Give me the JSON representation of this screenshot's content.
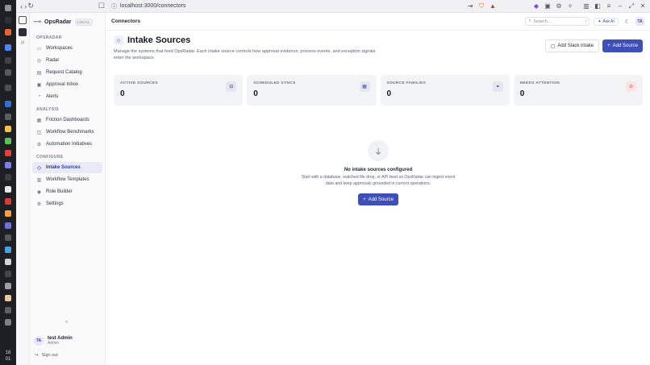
{
  "dock": {
    "clock_hour": "18",
    "clock_min": "01",
    "colors": [
      "#8f939a",
      "#2e3138",
      "#e8632d",
      "#4a87f5",
      "#3f4348",
      "#58595e",
      "#4b4e55",
      "#2f6fd6",
      "#5a5d63",
      "#f0c343",
      "#5cbf57",
      "#e2413a",
      "#7b7fe8",
      "#3a3d42",
      "#e9e9e9",
      "#d93b3b",
      "#efa33a",
      "#6c6fe0",
      "#55595f",
      "#47a3e0",
      "#cfd2d6",
      "#43464b",
      "#9a9ea4",
      "#e8c9a4",
      "#5c6066",
      "#7e8287"
    ]
  },
  "browser": {
    "url": "localhost:3000/connectors"
  },
  "sidebar": {
    "brand_name": "OpsRadar",
    "brand_badge": "LOCAL",
    "sections": [
      {
        "label": "OPSRADAR",
        "items": [
          {
            "label": "Workspaces",
            "icon": "folder-icon"
          },
          {
            "label": "Radar",
            "icon": "radar-icon"
          },
          {
            "label": "Request Catalog",
            "icon": "catalog-icon"
          },
          {
            "label": "Approval Inbox",
            "icon": "inbox-icon"
          },
          {
            "label": "Alerts",
            "icon": "bell-icon"
          }
        ]
      },
      {
        "label": "ANALYSIS",
        "items": [
          {
            "label": "Friction Dashboards",
            "icon": "dashboard-icon"
          },
          {
            "label": "Workflow Benchmarks",
            "icon": "benchmark-icon"
          },
          {
            "label": "Automation Initiatives",
            "icon": "gear-icon"
          }
        ]
      },
      {
        "label": "CONFIGURE",
        "items": [
          {
            "label": "Intake Sources",
            "icon": "intake-icon",
            "active": true
          },
          {
            "label": "Workflow Templates",
            "icon": "template-icon"
          },
          {
            "label": "Role Builder",
            "icon": "role-icon"
          },
          {
            "label": "Settings",
            "icon": "settings-icon"
          }
        ]
      }
    ],
    "collapse_glyph": "«",
    "user": {
      "initials": "TA",
      "name": "test Admin",
      "role": "Admin"
    },
    "sign_out": "Sign out"
  },
  "topbar": {
    "breadcrumb": "Connectors",
    "search_placeholder": "Search...",
    "search_kbd": "/",
    "ask_ai": "Ask AI",
    "avatar_initials": "TA"
  },
  "page": {
    "title": "Intake Sources",
    "description": "Manage the systems that feed OpsRadar. Each intake source controls how approval evidence, process events, and exception signals enter the workspace.",
    "add_slack": "Add Slack intake",
    "add_source": "Add Source"
  },
  "stats": [
    {
      "label": "ACTIVE SOURCES",
      "value": "0",
      "icon": "connector-icon"
    },
    {
      "label": "SCHEDULED SYNCS",
      "value": "0",
      "icon": "calendar-icon"
    },
    {
      "label": "SOURCE FAMILIES",
      "value": "0",
      "icon": "link-icon"
    },
    {
      "label": "NEEDS ATTENTION",
      "value": "0",
      "icon": "alert-icon",
      "accent": "#d04848"
    }
  ],
  "empty": {
    "title": "No intake sources configured",
    "description": "Start with a database, watched file drop, or API feed so OpsRadar can ingest event data and keep approvals grounded in current operations.",
    "button": "Add Source"
  }
}
